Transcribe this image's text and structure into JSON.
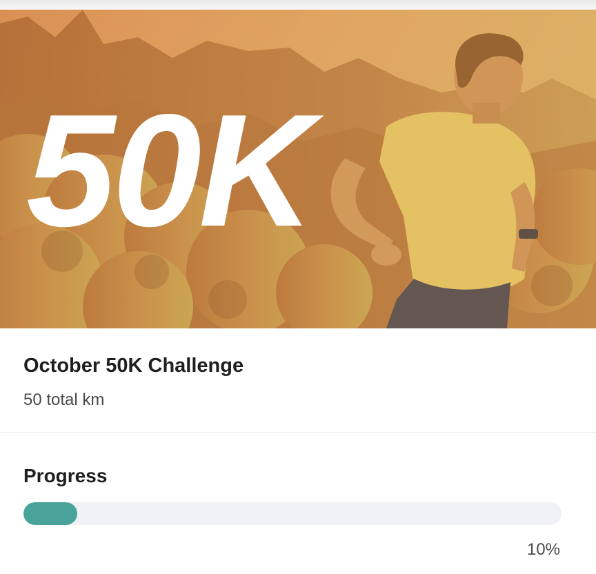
{
  "hero": {
    "title": "50K"
  },
  "challenge": {
    "title": "October 50K Challenge",
    "subtitle": "50 total km"
  },
  "progress": {
    "heading": "Progress",
    "percent_label": "10%",
    "fraction": 0.1
  },
  "colors": {
    "progress_fill": "#4aa39a",
    "progress_track": "#f0f2f5",
    "hero_overlay": "#e0a15a"
  }
}
